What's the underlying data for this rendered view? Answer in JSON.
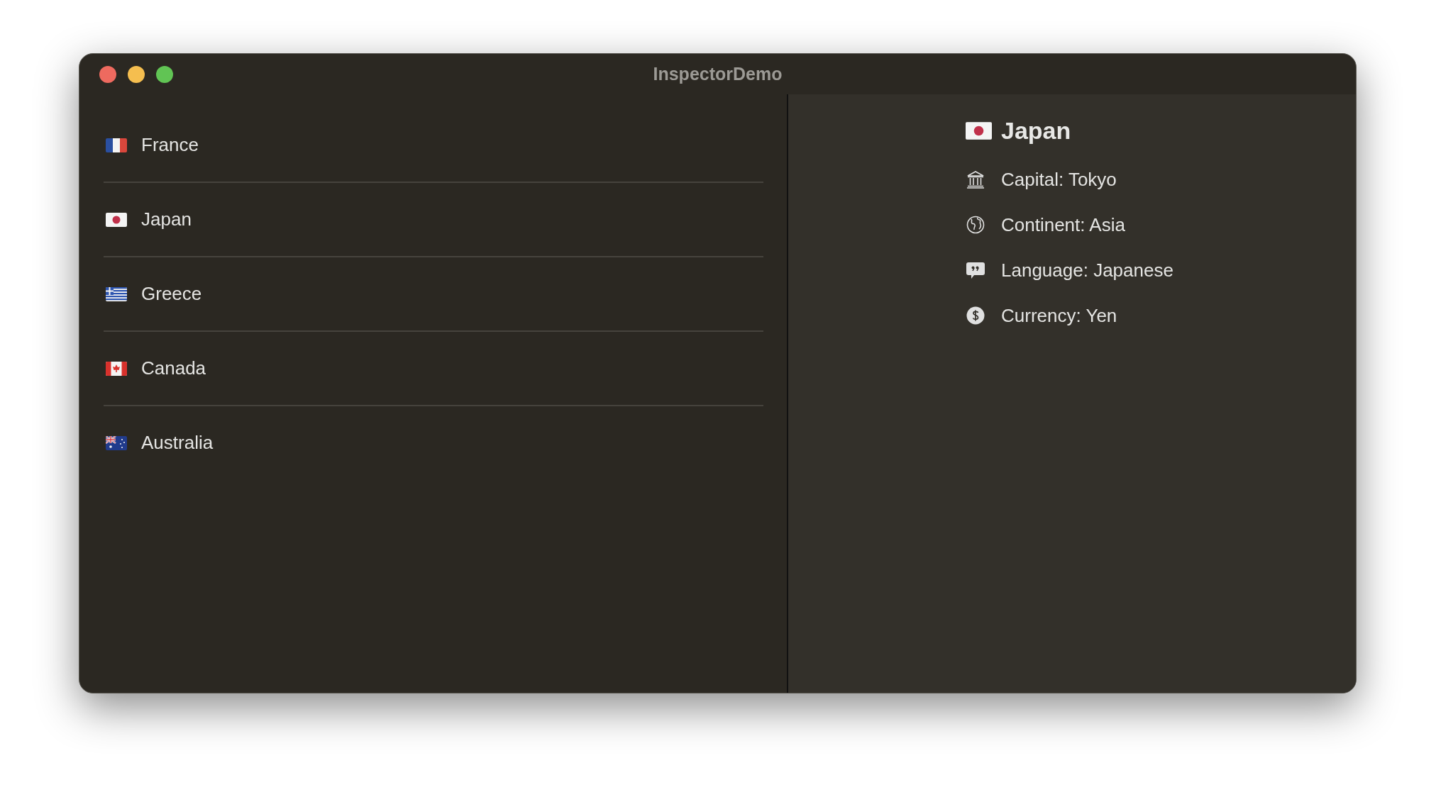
{
  "window": {
    "title": "InspectorDemo"
  },
  "countries": [
    {
      "name": "France",
      "kind": "fr"
    },
    {
      "name": "Japan",
      "kind": "jp"
    },
    {
      "name": "Greece",
      "kind": "gr"
    },
    {
      "name": "Canada",
      "kind": "ca"
    },
    {
      "name": "Australia",
      "kind": "au"
    }
  ],
  "detail": {
    "title": "Japan",
    "kind": "jp",
    "facts": [
      {
        "kind": "capital",
        "text": "Capital: Tokyo"
      },
      {
        "kind": "continent",
        "text": "Continent: Asia"
      },
      {
        "kind": "language",
        "text": "Language: Japanese"
      },
      {
        "kind": "currency",
        "text": "Currency: Yen"
      }
    ]
  }
}
